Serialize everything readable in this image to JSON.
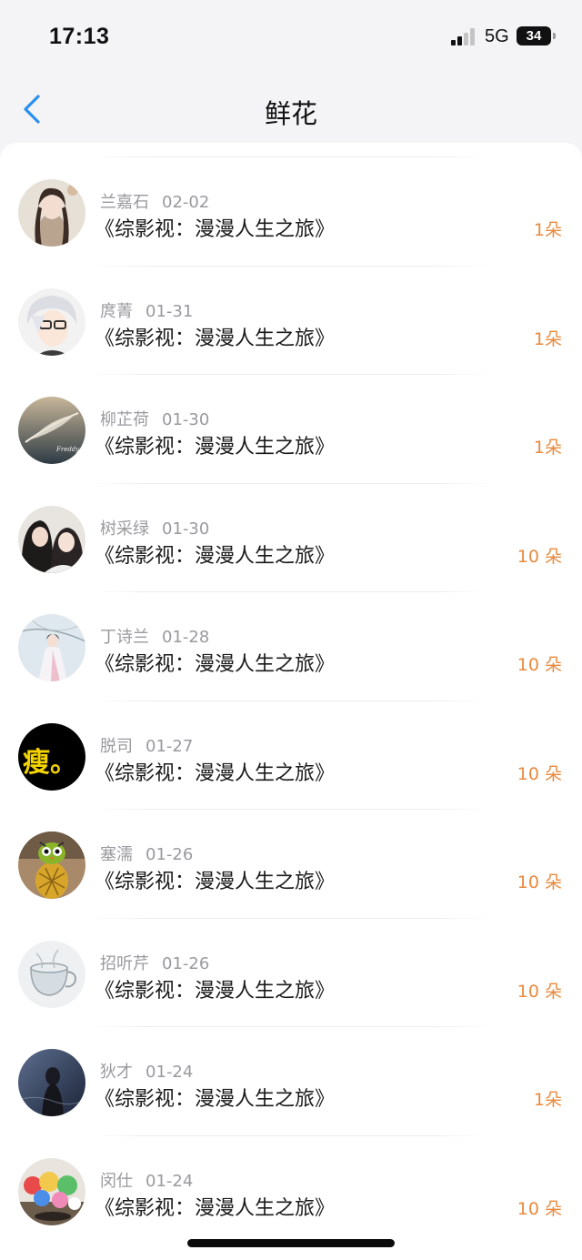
{
  "status": {
    "time": "17:13",
    "network": "5G",
    "battery": "34"
  },
  "header": {
    "back_icon": "chevron-left-icon",
    "title": "鲜花"
  },
  "colors": {
    "accent": "#2b8ff0",
    "count": "#e98a3e",
    "meta": "#9a9a9e"
  },
  "items": [
    {
      "name": "兰嘉石",
      "date": "02-02",
      "book": "《综影视：漫漫人生之旅》",
      "count": "1朵",
      "avatar": "avatar-ancient-portrait"
    },
    {
      "name": "庹菁",
      "date": "01-31",
      "book": "《综影视：漫漫人生之旅》",
      "count": "1朵",
      "avatar": "avatar-anime-glasses"
    },
    {
      "name": "柳芷荷",
      "date": "01-30",
      "book": "《综影视：漫漫人生之旅》",
      "count": "1朵",
      "avatar": "avatar-feather"
    },
    {
      "name": "树采绿",
      "date": "01-30",
      "book": "《综影视：漫漫人生之旅》",
      "count": "10 朵",
      "avatar": "avatar-two-girls"
    },
    {
      "name": "丁诗兰",
      "date": "01-28",
      "book": "《综影视：漫漫人生之旅》",
      "count": "10 朵",
      "avatar": "avatar-snow-girl"
    },
    {
      "name": "脱司",
      "date": "01-27",
      "book": "《综影视：漫漫人生之旅》",
      "count": "10 朵",
      "avatar": "avatar-text",
      "avatar_text": "瘦。"
    },
    {
      "name": "塞濡",
      "date": "01-26",
      "book": "《综影视：漫漫人生之旅》",
      "count": "10 朵",
      "avatar": "avatar-pineapple-owl"
    },
    {
      "name": "招听芹",
      "date": "01-26",
      "book": "《综影视：漫漫人生之旅》",
      "count": "10 朵",
      "avatar": "avatar-glass-cup"
    },
    {
      "name": "狄才",
      "date": "01-24",
      "book": "《综影视：漫漫人生之旅》",
      "count": "1朵",
      "avatar": "avatar-dark-figure"
    },
    {
      "name": "闵仕",
      "date": "01-24",
      "book": "《综影视：漫漫人生之旅》",
      "count": "10 朵",
      "avatar": "avatar-toys"
    }
  ]
}
